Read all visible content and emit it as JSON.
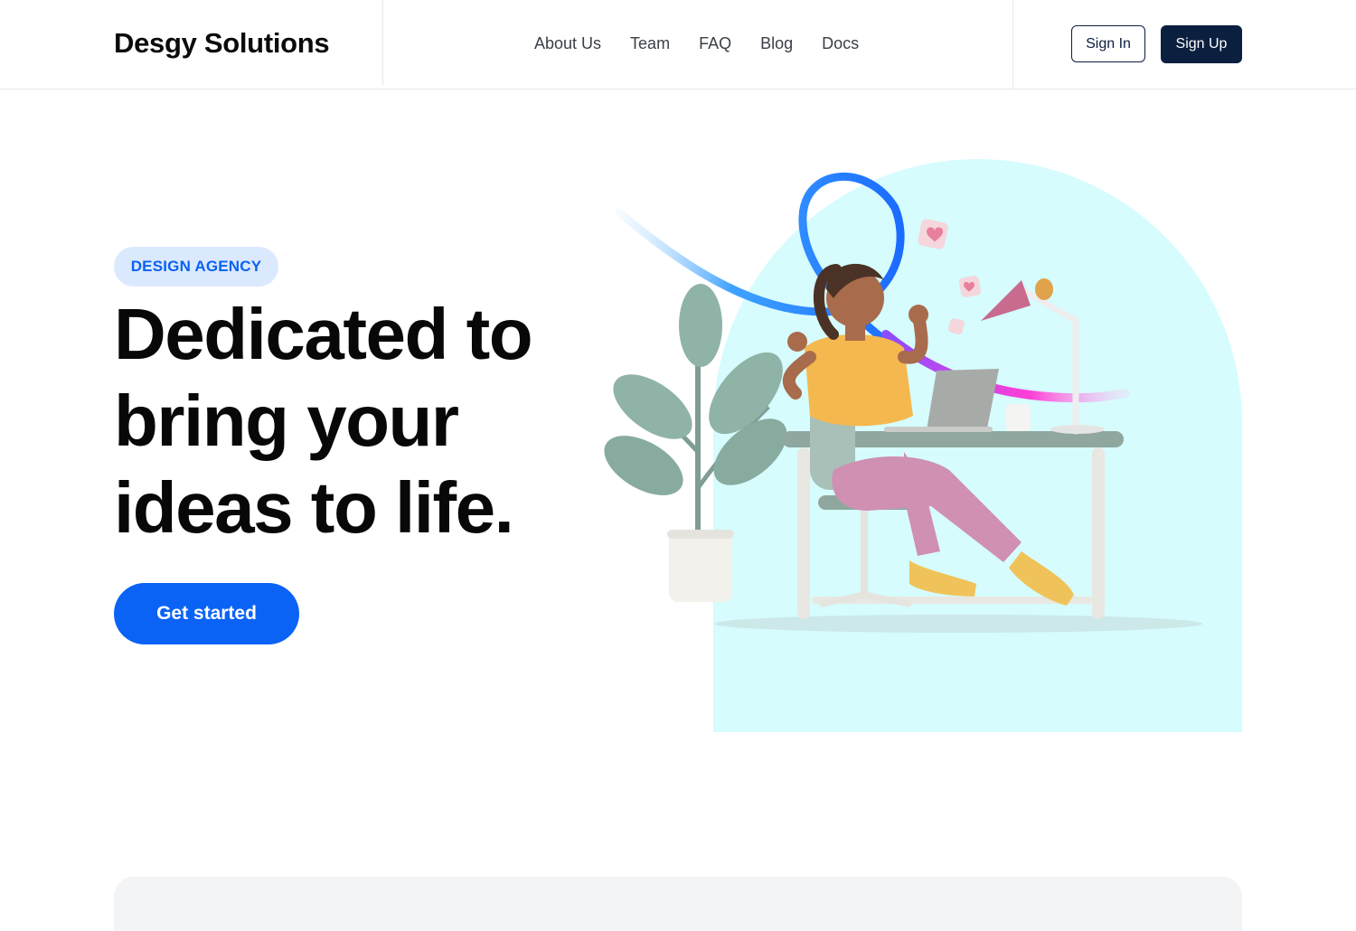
{
  "header": {
    "brand": "Desgy Solutions",
    "nav": [
      "About Us",
      "Team",
      "FAQ",
      "Blog",
      "Docs"
    ],
    "sign_in": "Sign In",
    "sign_up": "Sign Up"
  },
  "hero": {
    "badge": "DESIGN AGENCY",
    "headline_lines": [
      "Dedicated to",
      "bring your",
      "ideas to life."
    ],
    "cta": "Get started",
    "illustration": "woman-at-desk-with-laptop"
  },
  "colors": {
    "primary": "#0a63f5",
    "navy": "#0b1f3f",
    "badge_bg": "#dbe9ff",
    "arch_bg": "#d6fcfd"
  }
}
